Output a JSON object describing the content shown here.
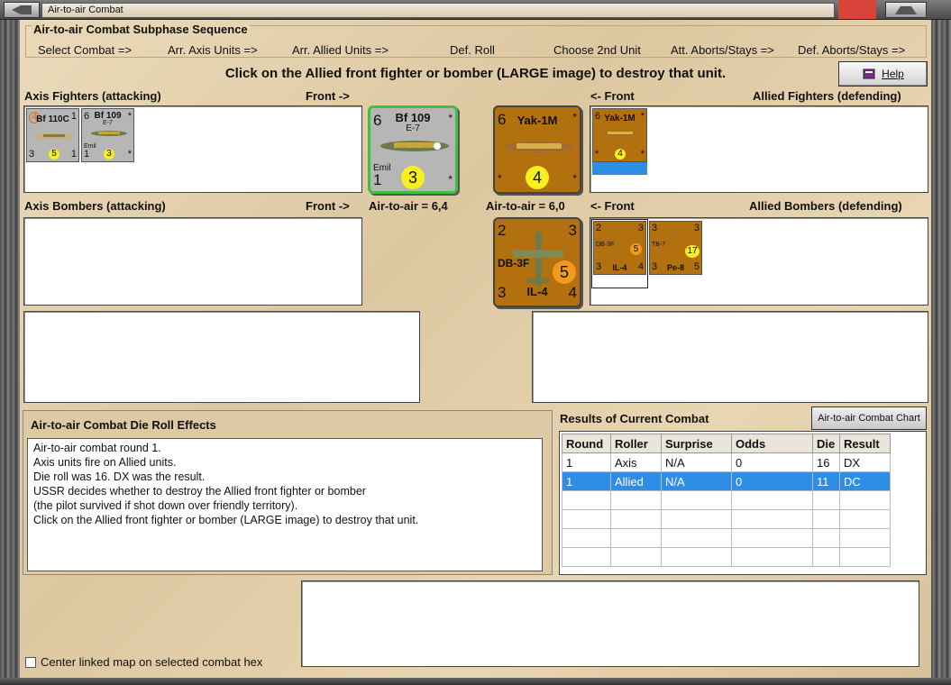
{
  "window": {
    "title": "Air-to-air Combat"
  },
  "subphase": {
    "heading": "Air-to-air Combat Subphase Sequence",
    "steps": [
      "Select Combat =>",
      "Arr. Axis Units =>",
      "Arr. Allied Units =>",
      "Def. Roll",
      "Choose 2nd Unit",
      "Att. Aborts/Stays =>",
      "Def. Aborts/Stays =>"
    ]
  },
  "instruction": "Click on the Allied front fighter or bomber (LARGE image) to destroy that unit.",
  "help_label": "Help",
  "labels": {
    "axis_fighters": "Axis Fighters (attacking)",
    "front_right1": "Front ->",
    "front_left1": "<- Front",
    "allied_fighters": "Allied Fighters (defending)",
    "axis_bombers": "Axis Bombers (attacking)",
    "front_right2": "Front ->",
    "axis_air": "Air-to-air = 6,4",
    "allied_air": "Air-to-air = 6,0",
    "front_left2": "<- Front",
    "allied_bombers": "Allied Bombers (defending)"
  },
  "units": {
    "axis_fighters": [
      {
        "name": "Bf 110C",
        "tl": "4",
        "tr": "1",
        "bl": "3",
        "br": "1",
        "circle": "5"
      },
      {
        "name": "Bf 109",
        "sub": "E-7",
        "sub2": "Emil",
        "tl": "6",
        "tr": "*",
        "bl": "1",
        "br": "*",
        "circle": "3"
      }
    ],
    "axis_front": {
      "name": "Bf 109",
      "sub": "E-7",
      "sub2": "Emil",
      "tl": "6",
      "tr": "*",
      "bl": "1",
      "br": "*",
      "circle": "3"
    },
    "allied_front_fighter": {
      "name": "Yak-1M",
      "tl": "6",
      "tr": "*",
      "bl": "*",
      "br": "*",
      "circle": "4"
    },
    "allied_fighters": [
      {
        "name": "Yak-1M",
        "tl": "6",
        "tr": "*",
        "bl": "*",
        "br": "*",
        "circle": "4"
      }
    ],
    "allied_front_bomber": {
      "name": "DB-3F",
      "sub": "IL-4",
      "tl": "2",
      "tr": "3",
      "bl": "3",
      "br": "4",
      "circle": "5"
    },
    "allied_bombers": [
      {
        "name": "DB-3F",
        "sub": "IL-4",
        "tl": "2",
        "tr": "3",
        "bl": "3",
        "br": "4",
        "circle": "5"
      },
      {
        "name": "TB-7",
        "sub": "Pe-8",
        "tl": "3",
        "tr": "3",
        "bl": "3",
        "br": "5",
        "circle": "17"
      }
    ]
  },
  "effects": {
    "heading": "Air-to-air Combat Die Roll Effects",
    "lines": [
      "Air-to-air combat round 1.",
      "Axis units fire on Allied units.",
      "Die roll was 16.  DX was the result.",
      "USSR decides whether to destroy the Allied front fighter or bomber",
      "(the pilot survived if shot down over friendly territory).",
      "Click on the Allied front fighter or bomber (LARGE image) to destroy that unit."
    ]
  },
  "results": {
    "heading": "Results of Current Combat",
    "chart_button": "Air-to-air Combat Chart",
    "columns": [
      "Round",
      "Roller",
      "Surprise",
      "Odds",
      "Die",
      "Result"
    ],
    "rows": [
      [
        "1",
        "Axis",
        "N/A",
        "0",
        "16",
        "DX"
      ],
      [
        "1",
        "Allied",
        "N/A",
        "0",
        "11",
        "DC"
      ]
    ]
  },
  "center_map_label": "Center linked map on selected combat hex",
  "colors": {
    "selection": "#2e8ee6",
    "counter_brown": "#b3700e",
    "counter_grey": "#b6b6b6",
    "circle_yellow": "#f8ef1f"
  }
}
